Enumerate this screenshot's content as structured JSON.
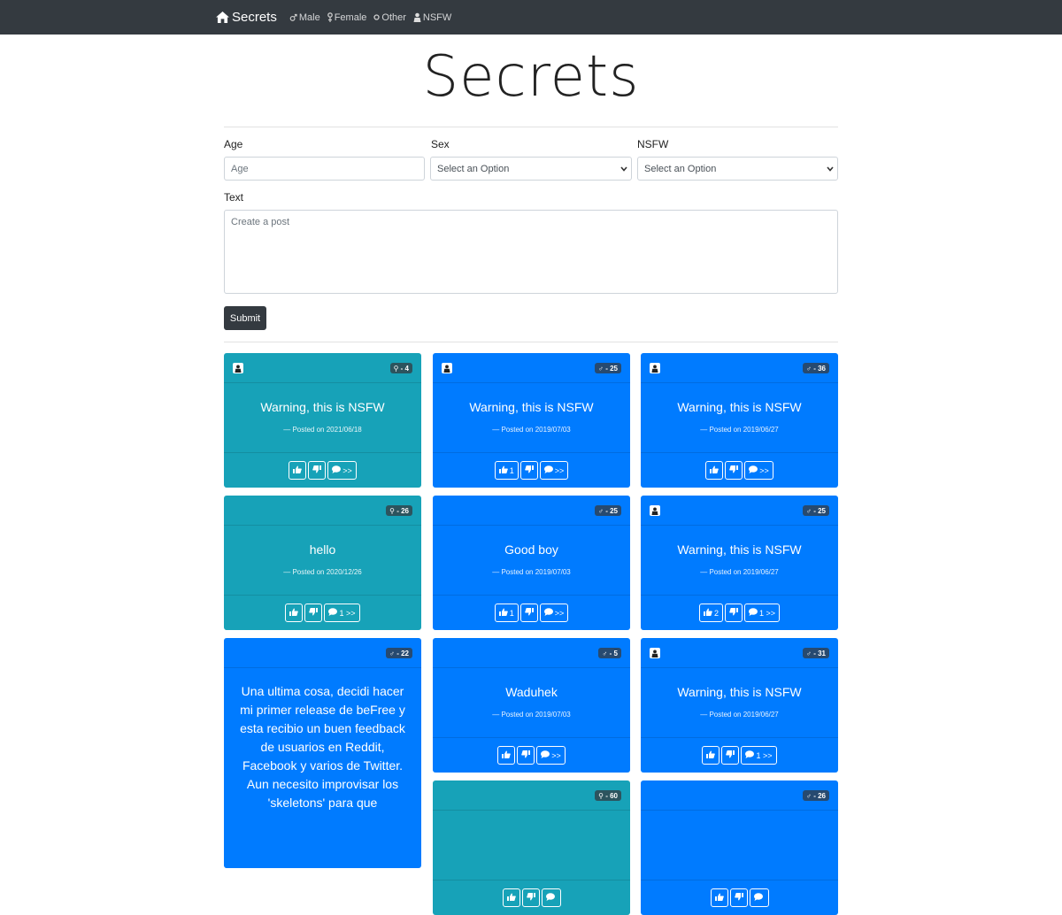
{
  "navbar": {
    "brand": "Secrets",
    "links": [
      {
        "label": "Male",
        "icon": "male-icon"
      },
      {
        "label": "Female",
        "icon": "female-icon"
      },
      {
        "label": "Other",
        "icon": "other-icon"
      },
      {
        "label": "NSFW",
        "icon": "nsfw-icon"
      }
    ]
  },
  "page_title": "Secrets",
  "form": {
    "age_label": "Age",
    "age_placeholder": "Age",
    "sex_label": "Sex",
    "sex_value": "Select an Option",
    "nsfw_label": "NSFW",
    "nsfw_value": "Select an Option",
    "text_label": "Text",
    "text_placeholder": "Create a post",
    "submit_label": "Submit"
  },
  "colors": {
    "navbar": "#343a40",
    "teal": "#17a2b8",
    "blue": "#007bff"
  },
  "posts": [
    {
      "color": "teal",
      "nsfw": true,
      "badge": "⚲ - 4",
      "sex": "other",
      "text": "Warning, this is NSFW",
      "posted": "Posted on 2021/06/18",
      "likes": "",
      "comments": ">>"
    },
    {
      "color": "blue",
      "nsfw": true,
      "badge": "♂ - 25",
      "sex": "male",
      "text": "Warning, this is NSFW",
      "posted": "Posted on 2019/07/03",
      "likes": "1",
      "comments": ">>"
    },
    {
      "color": "blue",
      "nsfw": true,
      "badge": "♂ - 36",
      "sex": "male",
      "text": "Warning, this is NSFW",
      "posted": "Posted on 2019/06/27",
      "likes": "",
      "comments": ">>"
    },
    {
      "color": "teal",
      "nsfw": false,
      "badge": "⚲ - 26",
      "sex": "other",
      "text": "hello",
      "posted": "Posted on 2020/12/26",
      "likes": "",
      "comments": "1 >>"
    },
    {
      "color": "blue",
      "nsfw": false,
      "badge": "♂ - 25",
      "sex": "male",
      "text": "Good boy",
      "posted": "Posted on 2019/07/03",
      "likes": "1",
      "comments": ">>"
    },
    {
      "color": "blue",
      "nsfw": true,
      "badge": "♂ - 25",
      "sex": "male",
      "text": "Warning, this is NSFW",
      "posted": "Posted on 2019/06/27",
      "likes": "2",
      "comments": "1 >>"
    },
    {
      "color": "blue",
      "nsfw": false,
      "badge": "♂ - 22",
      "sex": "male",
      "text": "Una ultima cosa, decidi hacer mi primer release de beFree y esta recibio un buen feedback de usuarios en Reddit, Facebook y varios de Twitter. Aun necesito improvisar los 'skeletons' para que",
      "posted": "",
      "likes": "",
      "comments": ""
    },
    {
      "color": "blue",
      "nsfw": false,
      "badge": "♂ - 5",
      "sex": "male",
      "text": "Waduhek",
      "posted": "Posted on 2019/07/03",
      "likes": "",
      "comments": ">>"
    },
    {
      "color": "blue",
      "nsfw": true,
      "badge": "♂ - 31",
      "sex": "male",
      "text": "Warning, this is NSFW",
      "posted": "Posted on 2019/06/27",
      "likes": "",
      "comments": "1 >>"
    },
    {
      "color": "teal",
      "nsfw": false,
      "badge": "⚲ - 60",
      "sex": "other",
      "text": "",
      "posted": "",
      "likes": "",
      "comments": ""
    },
    {
      "color": "blue",
      "nsfw": false,
      "badge": "♂ - 26",
      "sex": "male",
      "text": "",
      "posted": "",
      "likes": "",
      "comments": ""
    }
  ]
}
